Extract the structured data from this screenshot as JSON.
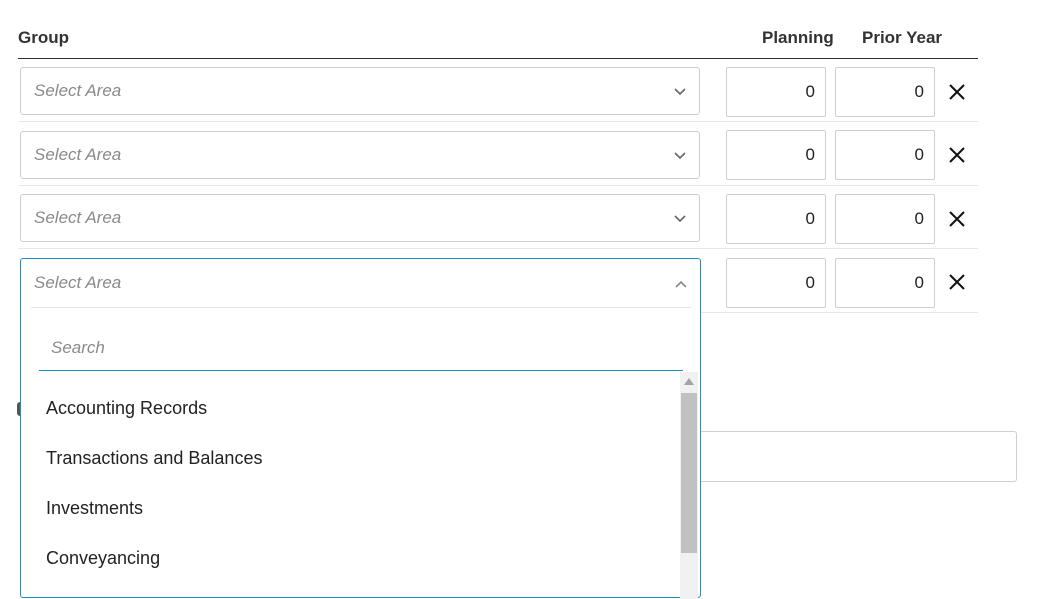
{
  "headers": {
    "group": "Group",
    "planning": "Planning",
    "prior_year": "Prior Year"
  },
  "rows": [
    {
      "area_placeholder": "Select Area",
      "planning": "0",
      "prior_year": "0"
    },
    {
      "area_placeholder": "Select Area",
      "planning": "0",
      "prior_year": "0"
    },
    {
      "area_placeholder": "Select Area",
      "planning": "0",
      "prior_year": "0"
    },
    {
      "area_placeholder": "Select Area",
      "planning": "0",
      "prior_year": "0"
    }
  ],
  "dropdown": {
    "search_placeholder": "Search",
    "options": [
      "Accounting Records",
      "Transactions and Balances",
      "Investments",
      "Conveyancing"
    ]
  },
  "colors": {
    "focus": "#1a8fc9",
    "border": "#cfcfcf",
    "placeholder": "#8a8a8a"
  },
  "icons": {
    "remove": "close-icon",
    "expand": "chevron-down-icon",
    "collapse": "chevron-up-icon"
  }
}
